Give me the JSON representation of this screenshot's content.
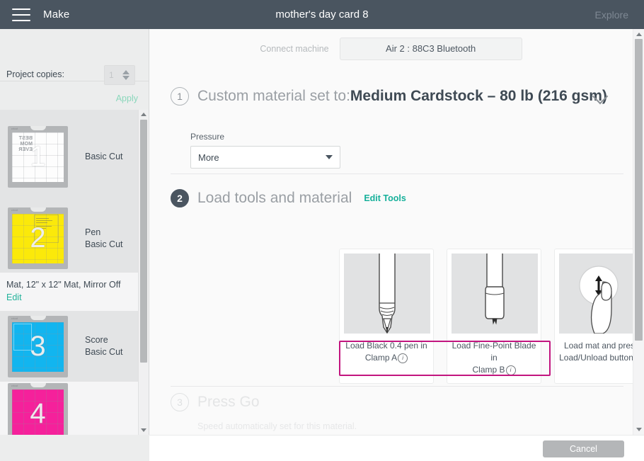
{
  "topbar": {
    "menu_icon": "hamburger-icon",
    "make_label": "Make",
    "project_title": "mother's day card 8",
    "explore_label": "Explore"
  },
  "sidebar": {
    "copies_label": "Project copies:",
    "copies_value": "1",
    "apply_label": "Apply",
    "mats": [
      {
        "number": "1",
        "title": "Basic Cut",
        "subtitle": "",
        "color": "#fdfdfd",
        "mirror_text": "BEST MOM EVER"
      },
      {
        "number": "2",
        "title": "Pen",
        "subtitle": "Basic Cut",
        "color": "#fbe90a",
        "mirror_text": ""
      },
      {
        "number": "3",
        "title": "Score",
        "subtitle": "Basic Cut",
        "color": "#12b5ef",
        "mirror_text": ""
      },
      {
        "number": "4",
        "title": "",
        "subtitle": "",
        "color": "#f5219b",
        "mirror_text": ""
      }
    ],
    "mat_meta": {
      "line": "Mat, 12\" x 12\" Mat, Mirror Off",
      "edit_label": "Edit"
    }
  },
  "main": {
    "connect_label": "Connect machine",
    "machine_name": "Air 2 : 88C3 Bluetooth",
    "step1": {
      "number": "1",
      "prefix": "Custom material set to:",
      "material": "Medium Cardstock – 80 lb (216 gsm)",
      "chevron_icon": "chevron-down-icon",
      "pressure_label": "Pressure",
      "pressure_value": "More"
    },
    "step2": {
      "number": "2",
      "title": "Load tools and material",
      "edit_tools_label": "Edit Tools",
      "cards": [
        {
          "icon": "pen-tip-icon",
          "caption_line1": "Load Black 0.4 pen in",
          "caption_line2": "Clamp A",
          "info_icon": "info-icon",
          "highlighted": true
        },
        {
          "icon": "fine-point-blade-icon",
          "caption_line1": "Load Fine-Point Blade in",
          "caption_line2": "Clamp B",
          "info_icon": "info-icon",
          "highlighted": true
        },
        {
          "icon": "finger-press-button-icon",
          "caption_line1": "Load mat and press",
          "caption_line2": "Load/Unload button",
          "info_icon": "info-icon",
          "highlighted": false
        }
      ],
      "highlight_color": "#c2157f"
    },
    "step3": {
      "number": "3",
      "title": "Press Go",
      "note": "Speed automatically set for this material."
    }
  },
  "bottombar": {
    "cancel_label": "Cancel"
  }
}
